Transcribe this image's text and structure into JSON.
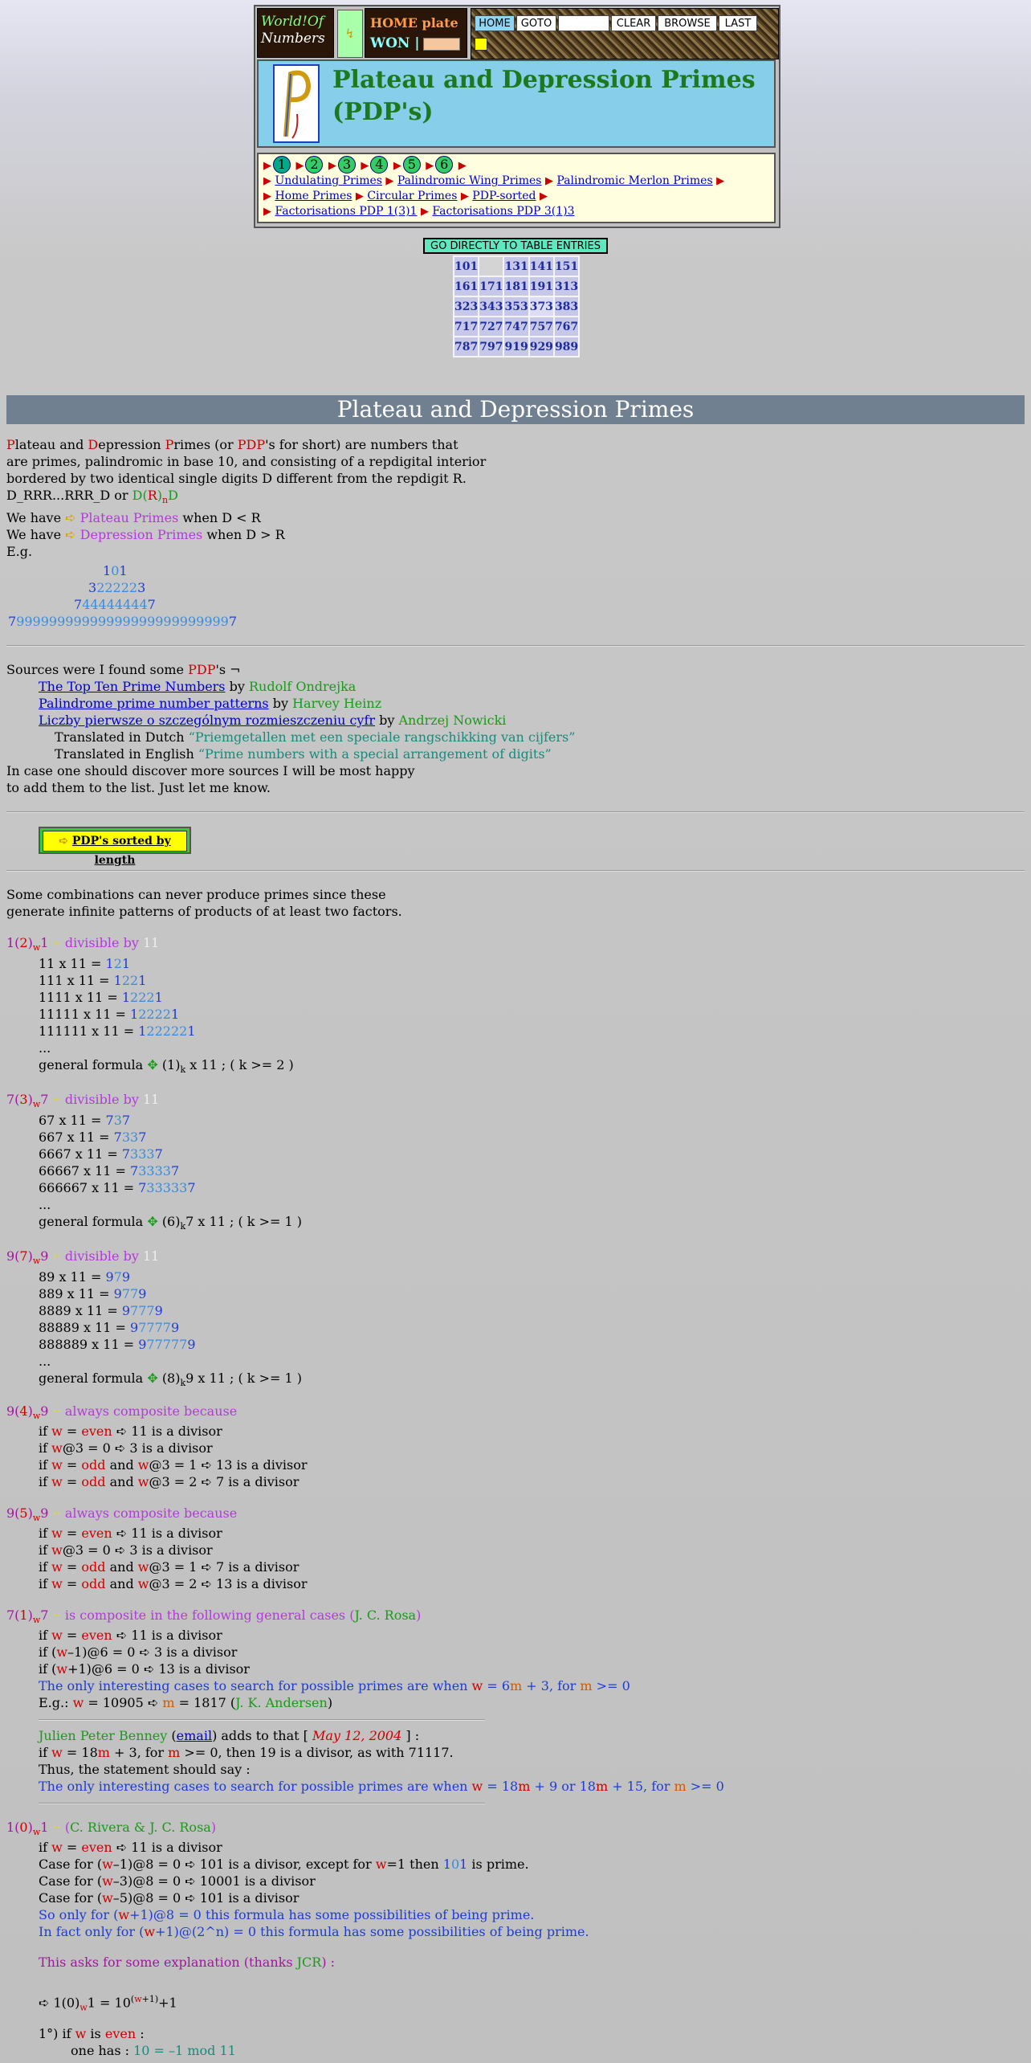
{
  "header": {
    "logo_line1": "World!Of",
    "logo_line2": "Numbers",
    "home_plate": "HOME plate",
    "won": "WON |",
    "tools": {
      "home": "HOME",
      "goto": "GOTO",
      "clear": "CLEAR",
      "browse": "BROWSE",
      "last": "LAST"
    },
    "title_line1": "Plateau and Depression Primes",
    "title_line2": "(PDP's)"
  },
  "nav": {
    "numbers": [
      "1",
      "2",
      "3",
      "4",
      "5",
      "6"
    ],
    "links_row1": [
      "Undulating Primes",
      "Palindromic Wing Primes",
      "Palindromic Merlon Primes"
    ],
    "links_row2": [
      "Home Primes",
      "Circular Primes",
      "PDP-sorted"
    ],
    "links_row3": [
      "Factorisations PDP 1(3)1",
      "Factorisations PDP 3(1)3"
    ]
  },
  "entries": {
    "go_button": "GO DIRECTLY TO TABLE ENTRIES",
    "rows": [
      [
        "101",
        "",
        "131",
        "141",
        "151"
      ],
      [
        "161",
        "171",
        "181",
        "191",
        "313"
      ],
      [
        "323",
        "343",
        "353",
        "373",
        "383"
      ],
      [
        "717",
        "727",
        "747",
        "757",
        "767"
      ],
      [
        "787",
        "797",
        "919",
        "929",
        "989"
      ]
    ]
  },
  "banner": "Plateau and Depression Primes",
  "intro": {
    "line1_rest": "rimes (or ",
    "line1_end": "'s for short) are numbers that",
    "line2": "are primes, palindromic in base 10, and consisting of a repdigital interior",
    "line3": "bordered by two identical single digits D different from the repdigit R.",
    "line4": "D_RRR...RRR_D or ",
    "plateau_line_a": "We have",
    "plateau_link": "Plateau Primes",
    "plateau_cond": "when D < R",
    "depression_link": "Depression Primes",
    "depression_cond": "when D > R",
    "eg": "E.g.",
    "examples": [
      {
        "d": "1",
        "r": "0"
      },
      {
        "d": "3",
        "r": "22222"
      },
      {
        "d": "7",
        "r": "44444444"
      },
      {
        "d": "7",
        "r": "99999999999999999999999999"
      }
    ]
  },
  "sources": {
    "heading_a": "Sources were I found some ",
    "heading_b": "PDP",
    "heading_c": "'s ¬",
    "items": [
      {
        "link": "The Top Ten Prime Numbers",
        "by": "by",
        "author": "Rudolf Ondrejka"
      },
      {
        "link": "Palindrome prime number patterns",
        "by": "by",
        "author": "Harvey Heinz"
      },
      {
        "link": "Liczby pierwsze o szczególnym rozmieszczeniu cyfr",
        "by": "by",
        "author": "Andrzej Nowicki"
      }
    ],
    "dutch_a": "Translated in Dutch ",
    "dutch_b": "“Priemgetallen met een speciale rangschikking van cijfers”",
    "english_a": "Translated in English ",
    "english_b": "“Prime numbers with a special arrangement of digits”",
    "more1": "In case one should discover more sources I will be most happy",
    "more2": "to add them to the list. Just let me know."
  },
  "sorted_button": "PDP's sorted by length",
  "combos": {
    "line1": "Some combinations can never produce primes since these",
    "line2": "generate infinite patterns of products of at least two factors."
  },
  "section1": {
    "div_text": "divisible by",
    "eleven": "11",
    "rows": [
      {
        "lhs": "11 x 11 = ",
        "a": "1",
        "m": "2",
        "b": "1"
      },
      {
        "lhs": "111 x 11 = ",
        "a": "1",
        "m": "22",
        "b": "1"
      },
      {
        "lhs": "1111 x 11 = ",
        "a": "1",
        "m": "222",
        "b": "1"
      },
      {
        "lhs": "11111 x 11 = ",
        "a": "1",
        "m": "2222",
        "b": "1"
      },
      {
        "lhs": "111111 x 11 = ",
        "a": "1",
        "m": "22222",
        "b": "1"
      }
    ],
    "formula_a": "general formula",
    "formula_b": "(1)",
    "formula_c": " x 11 ; ( k >= 2 )"
  },
  "section2": {
    "rows": [
      {
        "lhs": "67 x 11 = ",
        "a": "7",
        "m": "3",
        "b": "7"
      },
      {
        "lhs": "667 x 11 = ",
        "a": "7",
        "m": "33",
        "b": "7"
      },
      {
        "lhs": "6667 x 11 = ",
        "a": "7",
        "m": "333",
        "b": "7"
      },
      {
        "lhs": "66667 x 11 = ",
        "a": "7",
        "m": "3333",
        "b": "7"
      },
      {
        "lhs": "666667 x 11 = ",
        "a": "7",
        "m": "33333",
        "b": "7"
      }
    ],
    "formula_b": "(6)",
    "formula_c": "7 x 11 ; ( k >= 1 )"
  },
  "section3": {
    "rows": [
      {
        "lhs": "89 x 11 = ",
        "a": "9",
        "m": "7",
        "b": "9"
      },
      {
        "lhs": "889 x 11 = ",
        "a": "9",
        "m": "77",
        "b": "9"
      },
      {
        "lhs": "8889 x 11 = ",
        "a": "9",
        "m": "777",
        "b": "9"
      },
      {
        "lhs": "88889 x 11 = ",
        "a": "9",
        "m": "7777",
        "b": "9"
      },
      {
        "lhs": "888889 x 11 = ",
        "a": "9",
        "m": "77777",
        "b": "9"
      }
    ],
    "formula_b": "(8)",
    "formula_c": "9 x 11 ; ( k >= 1 )"
  },
  "section4": {
    "always": "always composite because",
    "l1": [
      "if ",
      "w",
      " = ",
      "even",
      " ",
      "11 is a divisor"
    ],
    "l2": [
      "if ",
      "w",
      "@3 = 0 ",
      "3 is a divisor"
    ],
    "l3": [
      "if ",
      "w",
      " = ",
      "odd",
      " and ",
      "w",
      "@3 = 1 ",
      "13 is a divisor"
    ],
    "l4": [
      "if ",
      "w",
      " = ",
      "odd",
      " and ",
      "w",
      "@3 = 2 ",
      "7 is a divisor"
    ]
  },
  "section5": {
    "l3_div": "7 is a divisor",
    "l4_div": "13 is a divisor"
  },
  "section6": {
    "head": "is composite in the following general cases",
    "rosa": "J. C. Rosa",
    "l1": "11 is a divisor",
    "l2a": "if (",
    "l2b": "–1)@6 = 0 ",
    "l2c": "3 is a divisor",
    "l3b": "+1)@6 = 0 ",
    "l3c": "13 is a divisor",
    "interesting_a": "The only interesting cases to search for possible primes are when ",
    "interesting_b": " = 6",
    "interesting_c": " + 3, for ",
    "interesting_d": " >= 0",
    "eg_a": "E.g.: ",
    "eg_b": " = 10905 ",
    "eg_c": " = 1817 (",
    "eg_d": "J. K. Andersen",
    "benney": "Julien Peter Benney",
    "email": "email",
    "adds": ") adds to that [ ",
    "date": "May 12, 2004",
    "adds_end": " ] :",
    "b1a": "if ",
    "b1b": " = 18",
    "b1c": " + 3, for ",
    "b1d": " >= 0, then 19 is a divisor, as with 71117.",
    "b2": "Thus, the statement should say :",
    "b3a": "The only interesting cases to search for possible primes are when ",
    "b3b": " = 18",
    "b3c": " + 9 or 18",
    "b3d": " + 15, for ",
    "b3e": " >= 0"
  },
  "section7": {
    "credit": "C. Rivera & J. C. Rosa",
    "c1": "11 is a divisor",
    "c2a": "Case for (",
    "c2b": "–1)@8 = 0 ",
    "c2c": "101 is a divisor, except for ",
    "c2d": "=1 then ",
    "c2e": " is prime.",
    "c3b": "–3)@8 = 0 ",
    "c3c": "10001 is a divisor",
    "c4b": "–5)@8 = 0 ",
    "c4c": "101 is a divisor",
    "so_a": "So only for (",
    "so_b": "+1)@8 = 0 this formula has some possibilities of being prime.",
    "in_a": "In fact only for (",
    "in_b": "+1)@(2^n) = 0 this formula has some possibilities of being prime.",
    "asks_a": "This asks for some explanation (thanks ",
    "asks_b": "JCR",
    "asks_c": ") :",
    "f_a": "1(0)",
    "f_b": "1 = 10",
    "f_c": "+1",
    "p1a": "1°) if ",
    "p1b": " is ",
    "p1c": "even",
    "p1d": " :",
    "one_has": "one has : ",
    "mod": "10 = –1 mod 11"
  }
}
